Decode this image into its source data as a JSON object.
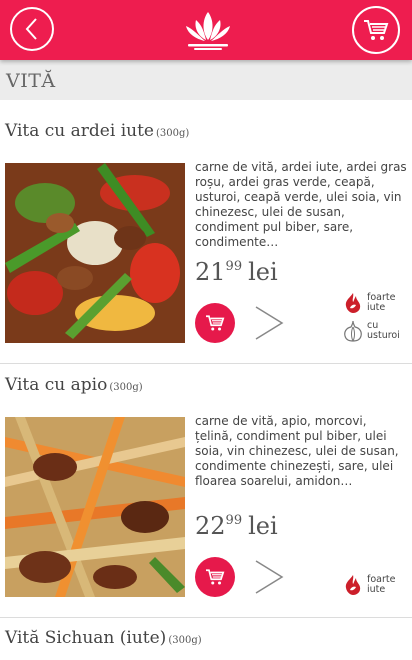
{
  "header": {
    "back_icon": "chevron-left-icon",
    "logo_icon": "lotus-logo-icon",
    "cart_icon": "cart-icon",
    "color": "#ee1d4f"
  },
  "category": {
    "title": "VITĂ"
  },
  "products": [
    {
      "name": "Vita cu ardei iute",
      "weight": "(300g)",
      "description": "carne de vită, ardei iute, ardei gras roșu, ardei gras verde, ceapă, usturoi, ceapă verde, ulei soia, vin chinezesc, ulei de susan, condiment pul biber, sare, condimente…",
      "price_int": "21",
      "price_dec": "99",
      "currency": "lei",
      "tags": [
        {
          "icon": "chili-fire-icon",
          "label": "foarte iute"
        },
        {
          "icon": "garlic-icon",
          "label": "cu usturoi"
        }
      ]
    },
    {
      "name": "Vita cu apio",
      "weight": "(300g)",
      "description": "carne de vită, apio, morcovi, țelină, condiment pul biber, ulei soia, vin chinezesc, ulei de susan, condimente chinezești, sare, ulei floarea soarelui, amidon…",
      "price_int": "22",
      "price_dec": "99",
      "currency": "lei",
      "tags": [
        {
          "icon": "chili-fire-icon",
          "label": "foarte iute"
        }
      ]
    },
    {
      "name": "Vită Sichuan (iute)",
      "weight": "(300g)"
    }
  ]
}
